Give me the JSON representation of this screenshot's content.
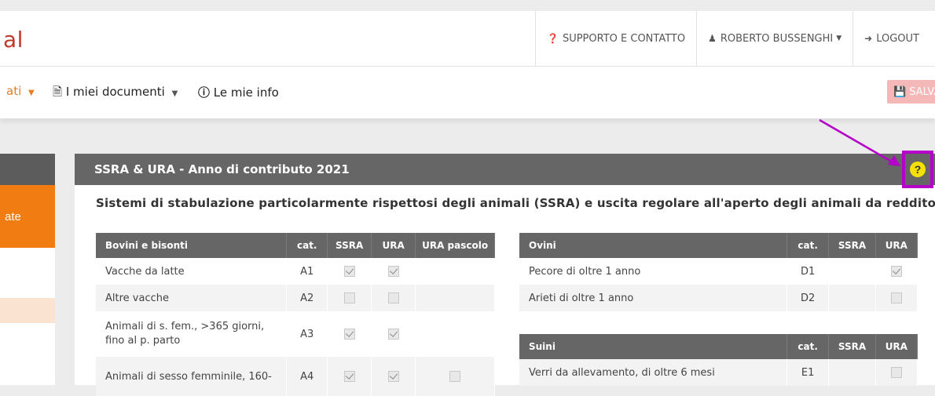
{
  "topbar": {
    "brand": "al",
    "support": "SUPPORTO E CONTATTO",
    "user": "ROBERTO BUSSENGHI",
    "logout": "LOGOUT"
  },
  "menubar": {
    "item1": "ati",
    "documents": "I miei documenti",
    "info": "Le mie info",
    "save": "SALVARE"
  },
  "sidebar": {
    "active_label": "ate"
  },
  "panel": {
    "title": "SSRA & URA - Anno di contributo 2021",
    "subtitle": "Sistemi di stabulazione particolarmente rispettosi degli animali (SSRA) e uscita regolare all'aperto degli animali da reddito (URA)"
  },
  "bovini": {
    "headers": [
      "Bovini e bisonti",
      "cat.",
      "SSRA",
      "URA",
      "URA pascolo"
    ],
    "rows": [
      {
        "name": "Vacche da latte",
        "cat": "A1",
        "ssra": true,
        "ura": true,
        "pascolo": null
      },
      {
        "name": "Altre vacche",
        "cat": "A2",
        "ssra": false,
        "ura": false,
        "pascolo": null
      },
      {
        "name": "Animali di s. fem., >365 giorni, fino al p. parto",
        "cat": "A3",
        "ssra": true,
        "ura": true,
        "pascolo": null
      },
      {
        "name": "Animali di sesso femminile, 160-",
        "cat": "A4",
        "ssra": true,
        "ura": true,
        "pascolo": false
      }
    ]
  },
  "ovini": {
    "headers": [
      "Ovini",
      "cat.",
      "SSRA",
      "URA"
    ],
    "rows": [
      {
        "name": "Pecore di oltre 1 anno",
        "cat": "D1",
        "ssra": null,
        "ura": true
      },
      {
        "name": "Arieti di oltre 1 anno",
        "cat": "D2",
        "ssra": null,
        "ura": false
      }
    ]
  },
  "suini": {
    "headers": [
      "Suini",
      "cat.",
      "SSRA",
      "URA"
    ],
    "rows": [
      {
        "name": "Verri da allevamento, di oltre 6 mesi",
        "cat": "E1",
        "ssra": null,
        "ura": false
      }
    ]
  },
  "colors": {
    "accent": "#f07c12",
    "brand": "#c0392b",
    "annotation": "#b400c8",
    "help": "#f5e100"
  },
  "icons": [
    "question-circle-icon",
    "user-icon",
    "logout-icon",
    "document-icon",
    "info-icon",
    "save-icon"
  ]
}
